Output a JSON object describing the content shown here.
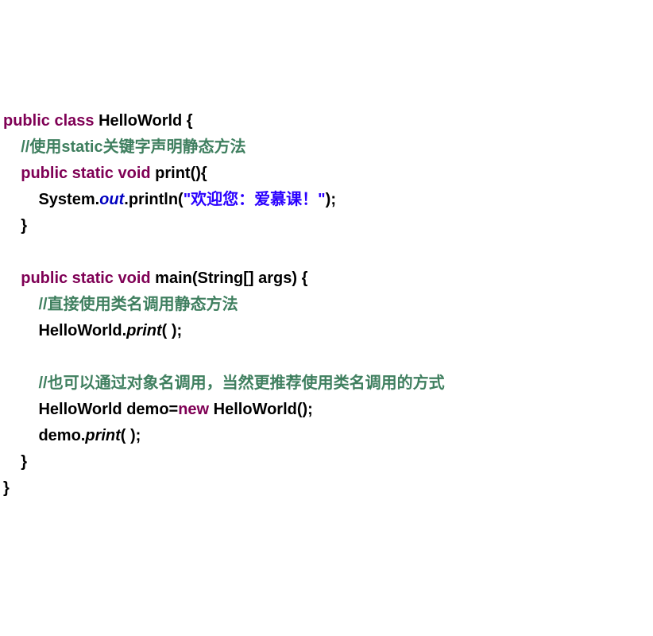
{
  "line1": {
    "kw1": "public class ",
    "cls": "HelloWorld",
    "brace": " {"
  },
  "line2": {
    "indent": "    ",
    "comment": "//使用static关键字声明静态方法"
  },
  "line3": {
    "indent": "    ",
    "kw1": "public static void ",
    "method": "print(){"
  },
  "line4": {
    "indent": "        ",
    "sys": "System.",
    "out": "out",
    "print": ".println(",
    "str": "\"欢迎您：爱慕课！\"",
    "end": ");"
  },
  "line5": {
    "indent": "    ",
    "brace": "}"
  },
  "line6": {
    "blank": " "
  },
  "line7": {
    "indent": "    ",
    "kw1": "public static void ",
    "method": "main(String[] args) {"
  },
  "line8": {
    "indent": "        ",
    "comment": "//直接使用类名调用静态方法"
  },
  "line9": {
    "indent": "        ",
    "cls": "HelloWorld.",
    "call": "print",
    "end": "( );"
  },
  "line10": {
    "blank": " "
  },
  "line11": {
    "indent": "        ",
    "comment": "//也可以通过对象名调用，当然更推荐使用类名调用的方式"
  },
  "line12": {
    "indent": "        ",
    "p1": "HelloWorld demo=",
    "kw": "new ",
    "p2": "HelloWorld();"
  },
  "line13": {
    "indent": "        ",
    "p1": "demo.",
    "call": "print",
    "end": "( );"
  },
  "line14": {
    "indent": "    ",
    "brace": "}"
  },
  "line15": {
    "brace": "}"
  }
}
